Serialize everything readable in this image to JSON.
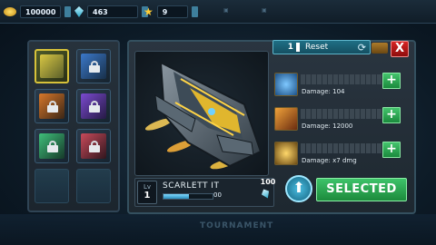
{
  "topbar": {
    "coins": "100000",
    "gems": "463",
    "stars": "9",
    "menu_items": [
      "",
      ""
    ]
  },
  "hangar": {
    "slots": [
      {
        "state": "active",
        "art": "ship-yellow"
      },
      {
        "state": "locked",
        "art": "ship-blue"
      },
      {
        "state": "locked",
        "art": "ship-orange"
      },
      {
        "state": "locked",
        "art": "ship-purple"
      },
      {
        "state": "locked",
        "art": "ship-green"
      },
      {
        "state": "locked",
        "art": "ship-red"
      },
      {
        "state": "empty",
        "art": ""
      },
      {
        "state": "empty",
        "art": ""
      }
    ]
  },
  "reset": {
    "count": "1",
    "label": "Reset"
  },
  "ship": {
    "level_label": "Lv",
    "level": "1",
    "name": "SCARLETT IT",
    "xp_value": "00",
    "xp_fraction": 0.52
  },
  "weapons": [
    {
      "icon": "bolt-orb-icon",
      "damage": "Damage: 104",
      "level": 0
    },
    {
      "icon": "missile-icon",
      "damage": "Damage: 12000",
      "level": 0
    },
    {
      "icon": "gear-drone-icon",
      "damage": "Damage: x7 dmg",
      "level": 0
    }
  ],
  "upgrade": {
    "cost": "100"
  },
  "actions": {
    "selected_label": "SELECTED",
    "close_label": "X",
    "plus_label": "+"
  },
  "background": {
    "label": "TOURNAMENT"
  },
  "colors": {
    "accent": "#2aa7c9",
    "selected": "#2bb35a",
    "close": "#c41a1a"
  }
}
